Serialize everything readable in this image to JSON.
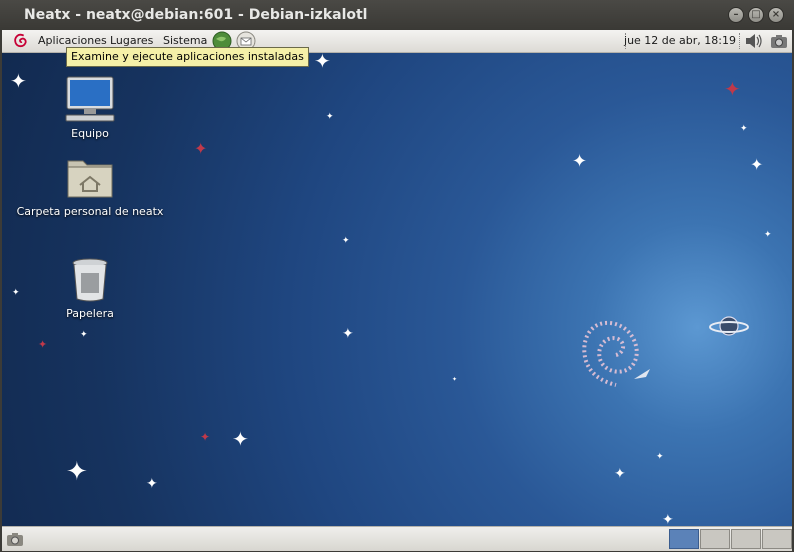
{
  "window": {
    "title": "Neatx - neatx@debian:601 - Debian-izkalotl"
  },
  "panel": {
    "menus": [
      "Aplicaciones",
      "Lugares",
      "Sistema"
    ],
    "clock": "jue 12 de abr, 18:19"
  },
  "tooltip": "Examine y ejecute aplicaciones instaladas",
  "desktop": {
    "icons": [
      {
        "label": "Equipo"
      },
      {
        "label": "Carpeta personal de neatx"
      },
      {
        "label": "Papelera"
      }
    ]
  },
  "colors": {
    "accent": "#5b82b8",
    "tooltip_bg": "#f5f0a8",
    "desktop_bg": "#1f4680"
  }
}
